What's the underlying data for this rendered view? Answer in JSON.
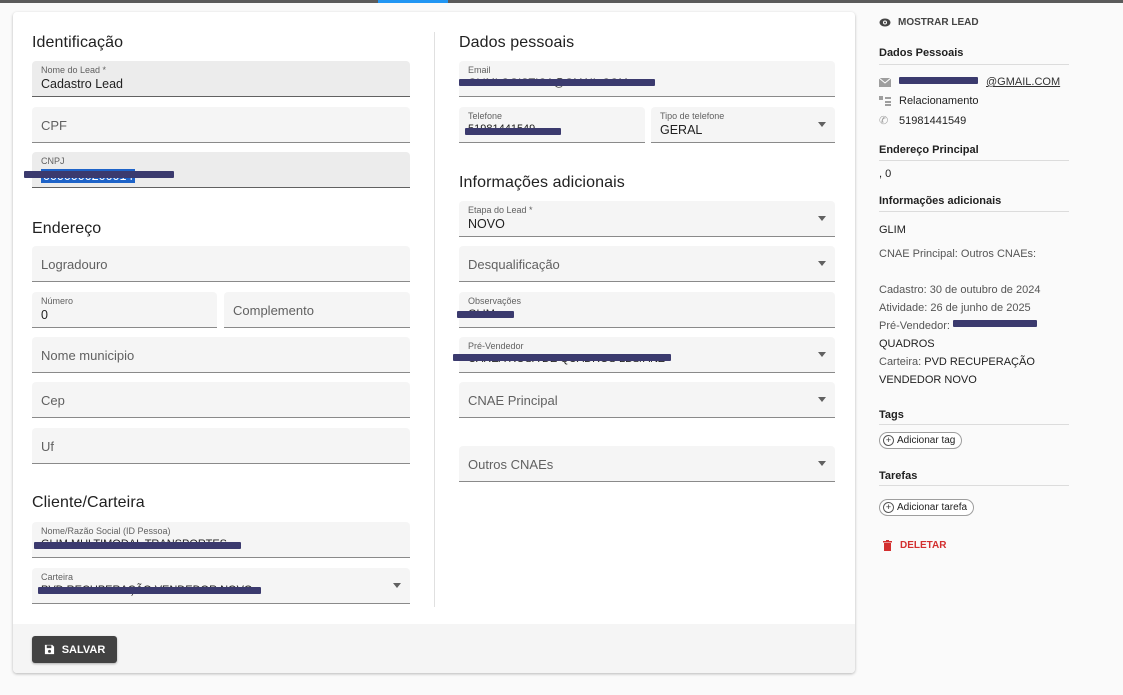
{
  "form": {
    "identificacao": {
      "title": "Identificação",
      "nome_label": "Nome do Lead *",
      "nome_value": "Cadastro Lead",
      "cpf_placeholder": "CPF",
      "cnpj_label": "CNPJ",
      "cnpj_value": "0000000200014"
    },
    "endereco": {
      "title": "Endereço",
      "logradouro_placeholder": "Logradouro",
      "numero_label": "Número",
      "numero_value": "0",
      "complemento_placeholder": "Complemento",
      "municipio_placeholder": "Nome municipio",
      "cep_placeholder": "Cep",
      "uf_placeholder": "Uf"
    },
    "cliente": {
      "title": "Cliente/Carteira",
      "razao_label": "Nome/Razão Social (ID Pessoa)",
      "razao_value": "GLIM MULTIMODAL TRANSPORTES",
      "carteira_label": "Carteira",
      "carteira_value": "PVD RECUPERAÇÃO VENDEDOR NOVO"
    },
    "dados_pessoais": {
      "title": "Dados pessoais",
      "email_label": "Email",
      "email_value": "GLIMLOGISTICA@GMAIL.COM",
      "telefone_label": "Telefone",
      "telefone_value": "51981441549",
      "tipo_label": "Tipo de telefone",
      "tipo_value": "GERAL"
    },
    "info": {
      "title": "Informações adicionais",
      "etapa_label": "Etapa do Lead *",
      "etapa_value": "NOVO",
      "desq_placeholder": "Desqualificação",
      "obs_label": "Observações",
      "obs_value": "GLIM",
      "prevend_label": "Pré-Vendedor",
      "prevend_value": "CAREA ROSA DE QUADROS LBS/ANZ",
      "cnae_placeholder": "CNAE Principal",
      "outros_placeholder": "Outros CNAEs"
    },
    "save_label": "SALVAR"
  },
  "sidebar": {
    "show_lead": "MOSTRAR LEAD",
    "dados_title": "Dados Pessoais",
    "email_suffix": "@GMAIL.COM",
    "relacionamento": "Relacionamento",
    "phone": "51981441549",
    "endereco_title": "Endereço Principal",
    "endereco_value": ", 0",
    "info_title": "Informações adicionais",
    "info_name": "GLIM",
    "cnae_line": "CNAE Principal: Outros CNAEs:",
    "cadastro": "Cadastro: 30 de outubro de 2024",
    "atividade": "Atividade: 26 de junho de 2025",
    "prevend_prefix": "Pré-Vendedor: ",
    "prevend_tail": "QUADROS",
    "carteira_prefix": "Carteira: ",
    "carteira_line1": "PVD RECUPERAÇÃO",
    "carteira_line2": "VENDEDOR NOVO",
    "tags_title": "Tags",
    "add_tag": "Adicionar tag",
    "tarefas_title": "Tarefas",
    "add_tarefa": "Adicionar tarefa",
    "delete": "DELETAR"
  },
  "colors": {
    "accent": "#2196f3",
    "danger": "#d32f2f",
    "button": "#424242",
    "redaction": "#3b3a6e"
  }
}
